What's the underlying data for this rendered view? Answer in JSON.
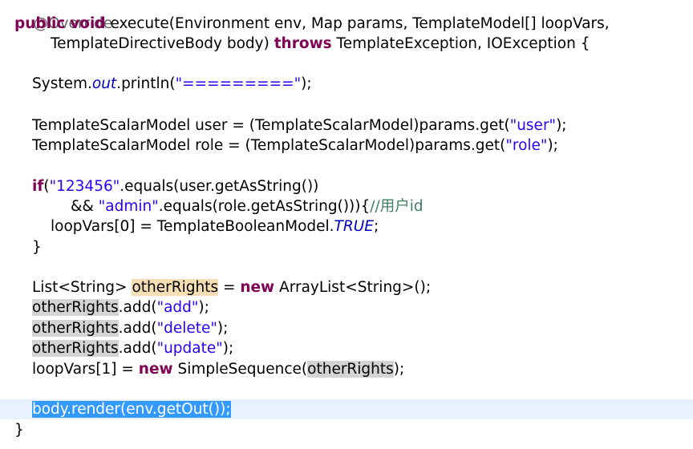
{
  "code": {
    "annotation": "@Override",
    "sig1": {
      "kw_public": "public",
      "kw_void": "void",
      "text": " execute(Environment env, Map params, TemplateModel[] loopVars,"
    },
    "sig2": {
      "text1": "TemplateDirectiveBody body) ",
      "kw_throws": "throws",
      "text2": " TemplateException, IOException {"
    },
    "print": {
      "prefix": "System.",
      "field": "out",
      "call": ".println(",
      "string": "\"=========\"",
      "suffix": ");"
    },
    "user_line": {
      "text": "TemplateScalarModel user = (TemplateScalarModel)params.get(",
      "string": "\"user\"",
      "suffix": ");"
    },
    "role_line": {
      "text": "TemplateScalarModel role = (TemplateScalarModel)params.get(",
      "string": "\"role\"",
      "suffix": ");"
    },
    "if_line": {
      "kw_if": "if",
      "paren": "(",
      "string": "\"123456\"",
      "text": ".equals(user.getAsString())"
    },
    "and_line": {
      "op": "&& ",
      "string": "\"admin\"",
      "text": ".equals(role.getAsString())){",
      "comment": "//用户id"
    },
    "loop0": {
      "text": "loopVars[0] = TemplateBooleanModel.",
      "field": "TRUE",
      "suffix": ";"
    },
    "close_if": "}",
    "list_line": {
      "text1": "List<String> ",
      "var": "otherRights",
      "text2": " = ",
      "kw_new": "new",
      "text3": " ArrayList<String>();"
    },
    "add_lines": [
      {
        "var": "otherRights",
        "call": ".add(",
        "string": "\"add\"",
        "suffix": ");"
      },
      {
        "var": "otherRights",
        "call": ".add(",
        "string": "\"delete\"",
        "suffix": ");"
      },
      {
        "var": "otherRights",
        "call": ".add(",
        "string": "\"update\"",
        "suffix": ");"
      }
    ],
    "loop1": {
      "text1": "loopVars[1] = ",
      "kw_new": "new",
      "text2": " SimpleSequence(",
      "var": "otherRights",
      "suffix": ");"
    },
    "render_line": "body.render(env.getOut());",
    "close_method": "}"
  }
}
